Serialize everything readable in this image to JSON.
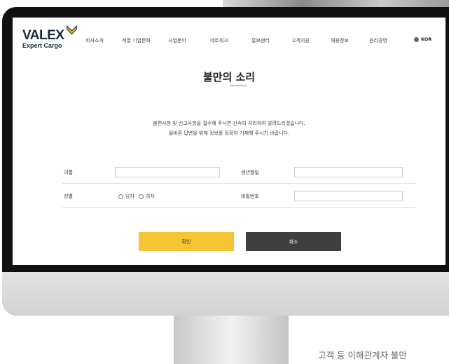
{
  "header": {
    "logo_word": "VALEX",
    "logo_sub": "Expert Cargo",
    "nav": [
      "회사소개",
      "계열 기업문화",
      "사업분야",
      "네트워크",
      "홍보센터",
      "고객지원",
      "채용정보",
      "윤리경영"
    ],
    "lang": "KOR"
  },
  "form": {
    "title": "불만의 소리",
    "intro_line1": "불편사항 및 신고사항을 접수해 주시면 신속히 처리하여 알려드리겠습니다.",
    "intro_line2": "올바른 답변을 위해 정보를 정확히 기재해 주시기 바랍니다.",
    "name_label": "이름",
    "birth_label": "생년월일",
    "gender_label": "성별",
    "male_label": "남자",
    "female_label": "여자",
    "password_label": "비밀번호",
    "confirm_label": "확인",
    "cancel_label": "취소"
  },
  "caption": "고객 등 이해관계자 불만",
  "colors": {
    "accent": "#f4c433",
    "dark_button": "#3f3f3f",
    "logo": "#1b2a3c"
  }
}
